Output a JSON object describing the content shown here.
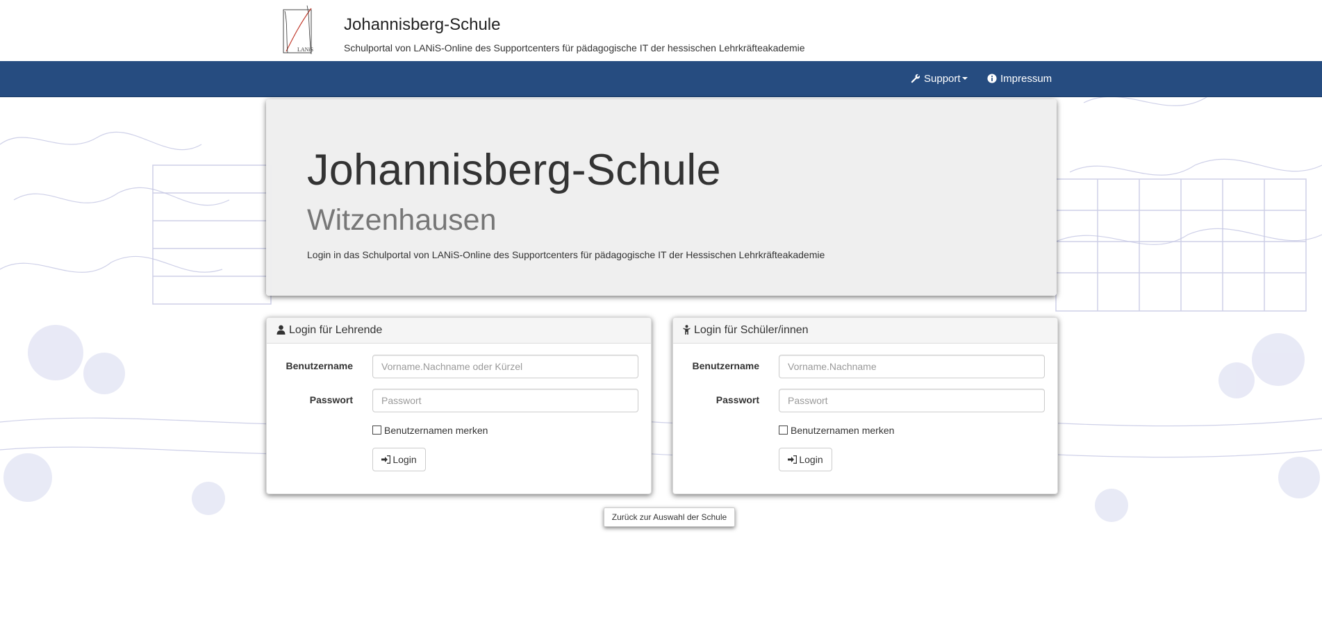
{
  "header": {
    "title": "Johannisberg-Schule",
    "subtitle": "Schulportal von LANiS-Online des Supportcenters für pädagogische IT der hessischen Lehrkräfteakademie",
    "logo_text": "LANiS"
  },
  "navbar": {
    "support_label": "Support",
    "impressum_label": "Impressum",
    "background_color": "#264c80"
  },
  "jumbotron": {
    "title": "Johannisberg-Schule",
    "subtitle": "Witzenhausen",
    "text": "Login in das Schulportal von LANiS-Online des Supportcenters für pädagogische IT der Hessischen Lehrkräfteakademie"
  },
  "teacher_login": {
    "heading": "Login für Lehrende",
    "username_label": "Benutzername",
    "username_placeholder": "Vorname.Nachname oder Kürzel",
    "password_label": "Passwort",
    "password_placeholder": "Passwort",
    "remember_label": "Benutzernamen merken",
    "login_button": "Login"
  },
  "student_login": {
    "heading": "Login für Schüler/innen",
    "username_label": "Benutzername",
    "username_placeholder": "Vorname.Nachname",
    "password_label": "Passwort",
    "password_placeholder": "Passwort",
    "remember_label": "Benutzernamen merken",
    "login_button": "Login"
  },
  "footer": {
    "back_button": "Zurück zur Auswahl der Schule"
  }
}
